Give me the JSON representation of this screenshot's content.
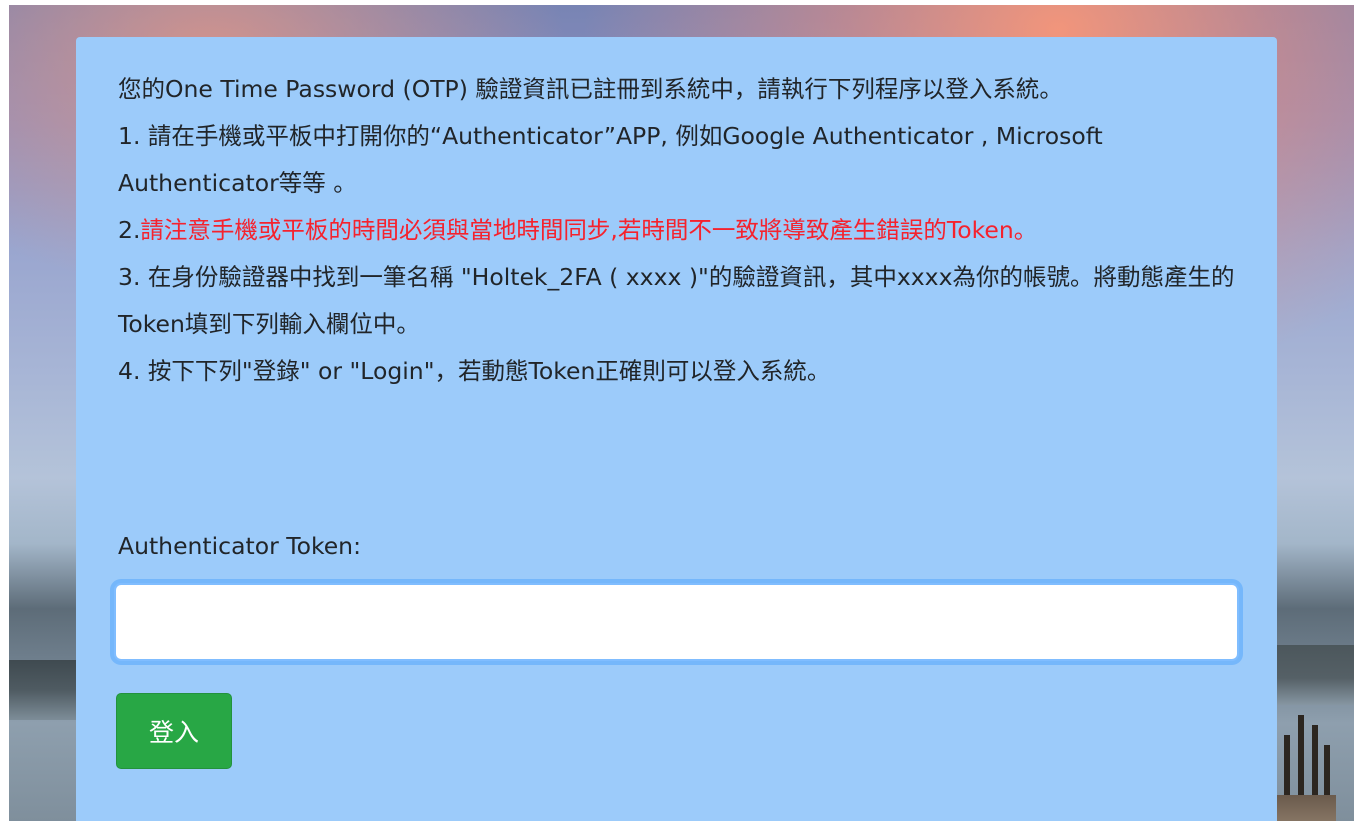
{
  "instructions": {
    "intro": "您的One Time Password (OTP) 驗證資訊已註冊到系統中，請執行下列程序以登入系統。",
    "step1": "1. 請在手機或平板中打開你的“Authenticator”APP, 例如Google Authenticator , Microsoft Authenticator等等 。",
    "step2_prefix": "2.",
    "step2_warning": "請注意手機或平板的時間必須與當地時間同步,若時間不一致將導致產生錯誤的Token。",
    "step3": "3. 在身份驗證器中找到一筆名稱 \"Holtek_2FA ( xxxx )\"的驗證資訊，其中xxxx為你的帳號。將動態產生的Token填到下列輸入欄位中。",
    "step4": "4. 按下下列\"登錄\" or \"Login\"，若動態Token正確則可以登入系統。"
  },
  "form": {
    "token_label": "Authenticator Token:",
    "token_value": "",
    "login_button": "登入"
  },
  "colors": {
    "card_background": "#9ccbfa",
    "warning_text": "#f5222d",
    "button_background": "#28a745",
    "input_focus_border": "#80bdff"
  }
}
